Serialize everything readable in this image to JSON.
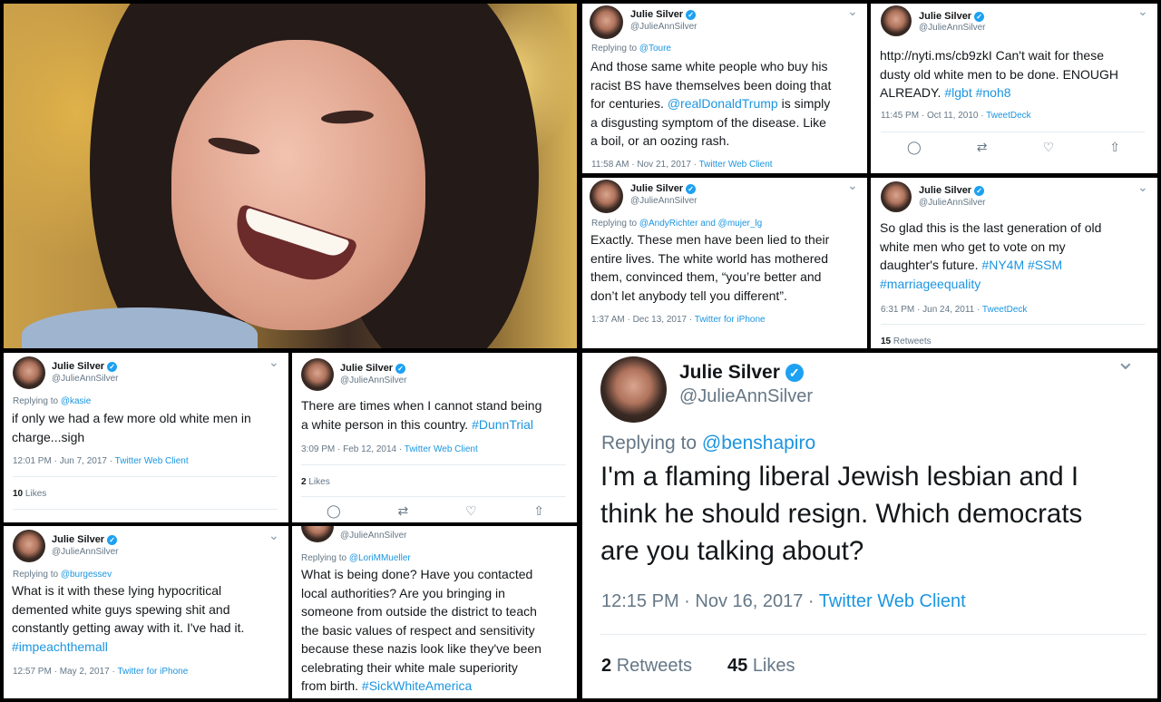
{
  "author": {
    "name": "Julie Silver",
    "handle": "@JulieAnnSilver",
    "verified_icon": "✓"
  },
  "icons": {
    "chevron": "⌄",
    "reply": "◯",
    "retweet": "⇄",
    "like": "♡",
    "share": "⇧"
  },
  "colors": {
    "accent": "#1b95e0",
    "muted": "#657786",
    "text": "#14171a"
  },
  "replying_prefix": "Replying to ",
  "tweets": [
    {
      "replying": "@Toure",
      "body": [
        "And those same white people who buy his",
        "racist BS have themselves been doing that",
        "for centuries. ",
        "@realDonaldTrump",
        " is simply",
        "a disgusting symptom of the disease. Like",
        "a boil, or an oozing rash."
      ],
      "time": "11:58 AM · Nov 21, 2017 · ",
      "client": "Twitter Web Client"
    },
    {
      "body_link": "http://nyti.ms/cb9zkI",
      "body_text": "  Can't wait for these",
      "body_line2": "dusty old white men to be done.  ENOUGH",
      "body_line3": "ALREADY. ",
      "tag1": "#lgbt",
      "tag2": "#noh8",
      "time": "11:45 PM · Oct 11, 2010 · ",
      "client": "TweetDeck"
    },
    {
      "replying": "@AndyRichter and @mujer_lg",
      "body": [
        "Exactly. These men have been lied to their",
        "entire lives. The white world has mothered",
        "them, convinced them, “you’re better and",
        "don’t let anybody tell you different”."
      ],
      "time": "1:37 AM · Dec 13, 2017 · ",
      "client": "Twitter for iPhone"
    },
    {
      "body": [
        "So glad this is the last generation of old",
        "white men who get to vote on my",
        "daughter's future.  "
      ],
      "tag1": "#NY4M",
      "tag2": "#SSM",
      "tag3": "#marriageequality",
      "time": "6:31 PM · Jun 24, 2011 · ",
      "client": "TweetDeck",
      "stat_num": "15",
      "stat_label": "Retweets"
    },
    {
      "replying": "@kasie",
      "body": [
        "if only we had a few more old white men in",
        "charge...sigh"
      ],
      "time": "12:01 PM · Jun 7, 2017 · ",
      "client": "Twitter Web Client",
      "stat_num": "10",
      "stat_label": "Likes"
    },
    {
      "body": [
        "There are times when I cannot stand being",
        "a white person in this country. "
      ],
      "tag1": "#DunnTrial",
      "time": "3:09 PM · Feb 12, 2014 · ",
      "client": "Twitter Web Client",
      "stat_num": "2",
      "stat_label": "Likes"
    },
    {
      "replying": "@burgessev",
      "body": [
        "What is it with these lying hypocritical",
        "demented white guys spewing shit and",
        "constantly getting away with it. I've had it."
      ],
      "tag1": "#impeachthemall",
      "time": "12:57 PM · May 2, 2017 · ",
      "client": "Twitter for iPhone"
    },
    {
      "replying": "@LoriMMueller",
      "body": [
        "What is being done? Have you contacted",
        "local authorities? Are you bringing in",
        "someone from outside the district to teach",
        "the basic values of respect and sensitivity",
        "because these nazis look like they've been",
        "celebrating their white male superiority",
        "from birth. "
      ],
      "tag1": "#SickWhiteAmerica"
    },
    {
      "replying": "@benshapiro",
      "body": [
        "I'm a flaming liberal Jewish lesbian and I",
        "think he should resign. Which democrats",
        "are you talking about?"
      ],
      "time": "12:15 PM · Nov 16, 2017 · ",
      "client": "Twitter Web Client",
      "rt_num": "2",
      "rt_label": "Retweets",
      "likes_num": "45",
      "likes_label": "Likes"
    }
  ]
}
